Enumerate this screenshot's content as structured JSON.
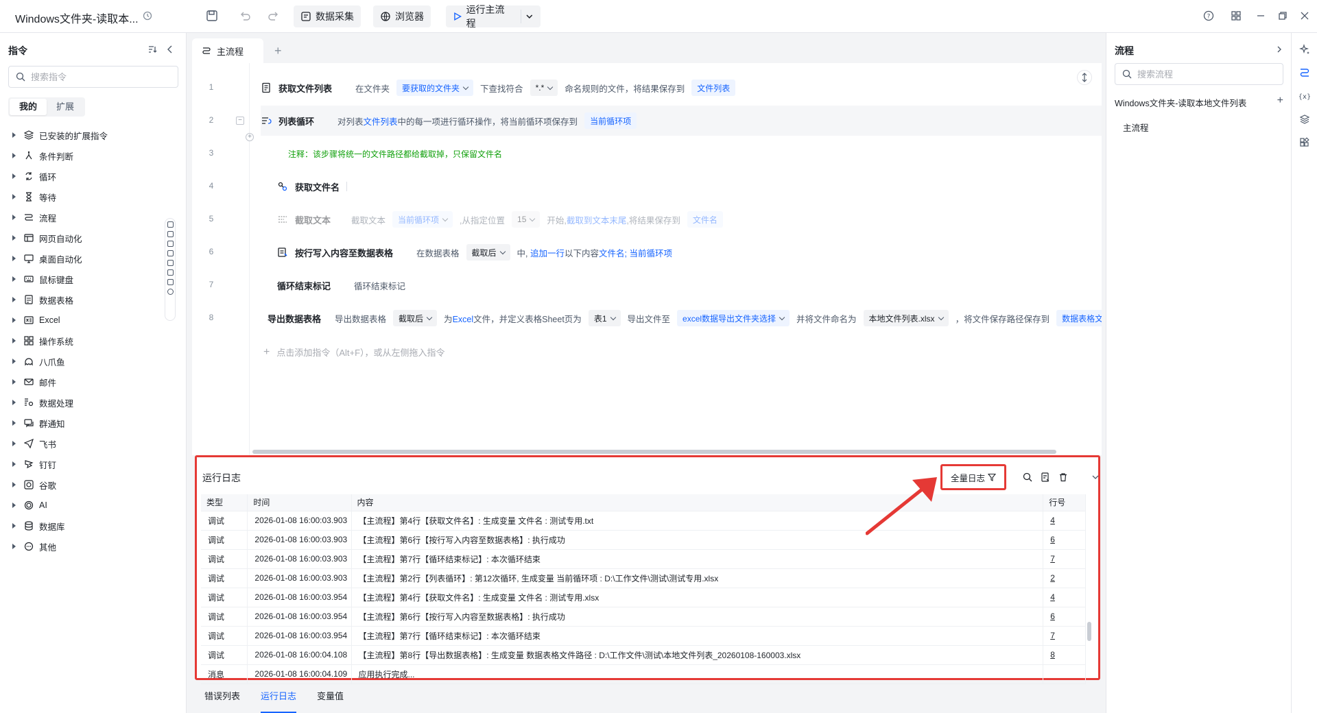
{
  "app": {
    "title": "Windows文件夹-读取本...",
    "toolbar": {
      "data_collect": "数据采集",
      "browser": "浏览器",
      "run_main": "运行主流程"
    }
  },
  "left_panel": {
    "title": "指令",
    "search_placeholder": "搜索指令",
    "tabs": [
      {
        "label": "我的",
        "active": true
      },
      {
        "label": "扩展",
        "active": false
      }
    ],
    "categories": [
      {
        "label": "已安装的扩展指令",
        "icon": "stack-icon"
      },
      {
        "label": "条件判断",
        "icon": "branch-icon"
      },
      {
        "label": "循环",
        "icon": "loop-icon"
      },
      {
        "label": "等待",
        "icon": "hourglass-icon"
      },
      {
        "label": "流程",
        "icon": "flow-icon"
      },
      {
        "label": "网页自动化",
        "icon": "browser-window-icon"
      },
      {
        "label": "桌面自动化",
        "icon": "monitor-icon"
      },
      {
        "label": "鼠标键盘",
        "icon": "keyboard-icon"
      },
      {
        "label": "数据表格",
        "icon": "document-icon"
      },
      {
        "label": "Excel",
        "icon": "excel-icon"
      },
      {
        "label": "操作系统",
        "icon": "grid-icon"
      },
      {
        "label": "八爪鱼",
        "icon": "octopus-icon"
      },
      {
        "label": "邮件",
        "icon": "mail-icon"
      },
      {
        "label": "数据处理",
        "icon": "data-process-icon"
      },
      {
        "label": "群通知",
        "icon": "chat-icon"
      },
      {
        "label": "飞书",
        "icon": "send-icon"
      },
      {
        "label": "钉钉",
        "icon": "dingtalk-icon"
      },
      {
        "label": "谷歌",
        "icon": "google-icon"
      },
      {
        "label": "AI",
        "icon": "ai-icon"
      },
      {
        "label": "数据库",
        "icon": "database-icon"
      },
      {
        "label": "其他",
        "icon": "more-circle-icon"
      }
    ]
  },
  "editor": {
    "tab_label": "主流程",
    "add_hint": "点击添加指令（Alt+F），或从左侧拖入指令",
    "lines": [
      {
        "no": "1",
        "cmd": "获取文件列表",
        "t1": "在文件夹",
        "p1": "要获取的文件夹",
        "t2": "下查找符合",
        "p2": "*.*",
        "t3": "命名规则的文件，将结果保存到",
        "v1": "文件列表"
      },
      {
        "no": "2",
        "cmd": "列表循环",
        "t1": "对列表",
        "v1": "文件列表",
        "t2": "中的每一项进行循环操作，将当前循环项保存到",
        "v2": "当前循环项"
      },
      {
        "no": "3",
        "note": "注释：该步骤将统一的文件路径都给截取掉，只保留文件名"
      },
      {
        "no": "4",
        "cmd": "获取文件名"
      },
      {
        "no": "5",
        "cmd": "截取文本",
        "t1": "截取文本",
        "p1": "当前循环项",
        "t2": ",从指定位置",
        "p2": "15",
        "t3": "开始,",
        "v1": "截取到文本末尾",
        "t4": ",将结果保存到",
        "v2": "文件名"
      },
      {
        "no": "6",
        "cmd": "按行写入内容至数据表格",
        "t1": "在数据表格",
        "p1": "截取后",
        "t2": "中,",
        "v1": "追加一行",
        "t3": "以下内容",
        "v2": "文件名; 当前循环项"
      },
      {
        "no": "7",
        "cmd": "循环结束标记",
        "t1": "循环结束标记"
      },
      {
        "no": "8",
        "cmd": "导出数据表格",
        "t1": "导出数据表格",
        "p1": "截取后",
        "t2": "为",
        "v1": "Excel",
        "t3": "文件，并定义表格Sheet页为",
        "p2": "表1",
        "t4": "导出文件至",
        "p3": "excel数据导出文件夹选择",
        "t5": "并将文件命名为",
        "p4": "本地文件列表.xlsx",
        "t6": "，将文件保存路径保存到",
        "v2": "数据表格文件"
      }
    ]
  },
  "log": {
    "title": "运行日志",
    "filter_label": "全量日志",
    "columns": [
      "类型",
      "时间",
      "内容",
      "行号"
    ],
    "rows": [
      [
        "调试",
        "2026-01-08 16:00:03.903",
        "【主流程】第4行【获取文件名】: 生成变量 文件名 : 测试专用.txt",
        "4"
      ],
      [
        "调试",
        "2026-01-08 16:00:03.903",
        "【主流程】第6行【按行写入内容至数据表格】: 执行成功",
        "6"
      ],
      [
        "调试",
        "2026-01-08 16:00:03.903",
        "【主流程】第7行【循环结束标记】: 本次循环结束",
        "7"
      ],
      [
        "调试",
        "2026-01-08 16:00:03.903",
        "【主流程】第2行【列表循环】: 第12次循环, 生成变量 当前循环项 : D:\\工作文件\\测试\\测试专用.xlsx",
        "2"
      ],
      [
        "调试",
        "2026-01-08 16:00:03.954",
        "【主流程】第4行【获取文件名】: 生成变量 文件名 : 测试专用.xlsx",
        "4"
      ],
      [
        "调试",
        "2026-01-08 16:00:03.954",
        "【主流程】第6行【按行写入内容至数据表格】: 执行成功",
        "6"
      ],
      [
        "调试",
        "2026-01-08 16:00:03.954",
        "【主流程】第7行【循环结束标记】: 本次循环结束",
        "7"
      ],
      [
        "调试",
        "2026-01-08 16:00:04.108",
        "【主流程】第8行【导出数据表格】: 生成变量 数据表格文件路径 : D:\\工作文件\\测试\\本地文件列表_20260108-160003.xlsx",
        "8"
      ],
      [
        "消息",
        "2026-01-08 16:00:04.109",
        "应用执行完成...",
        ""
      ]
    ]
  },
  "bottom_tabs": [
    {
      "label": "错误列表",
      "active": false
    },
    {
      "label": "运行日志",
      "active": true
    },
    {
      "label": "变量值",
      "active": false
    }
  ],
  "right_panel": {
    "title": "流程",
    "search_placeholder": "搜索流程",
    "project": "Windows文件夹-读取本地文件列表",
    "main_flow": "主流程"
  },
  "colors": {
    "accent": "#1664ff",
    "annotation": "#e53935",
    "note": "#13a10e"
  }
}
